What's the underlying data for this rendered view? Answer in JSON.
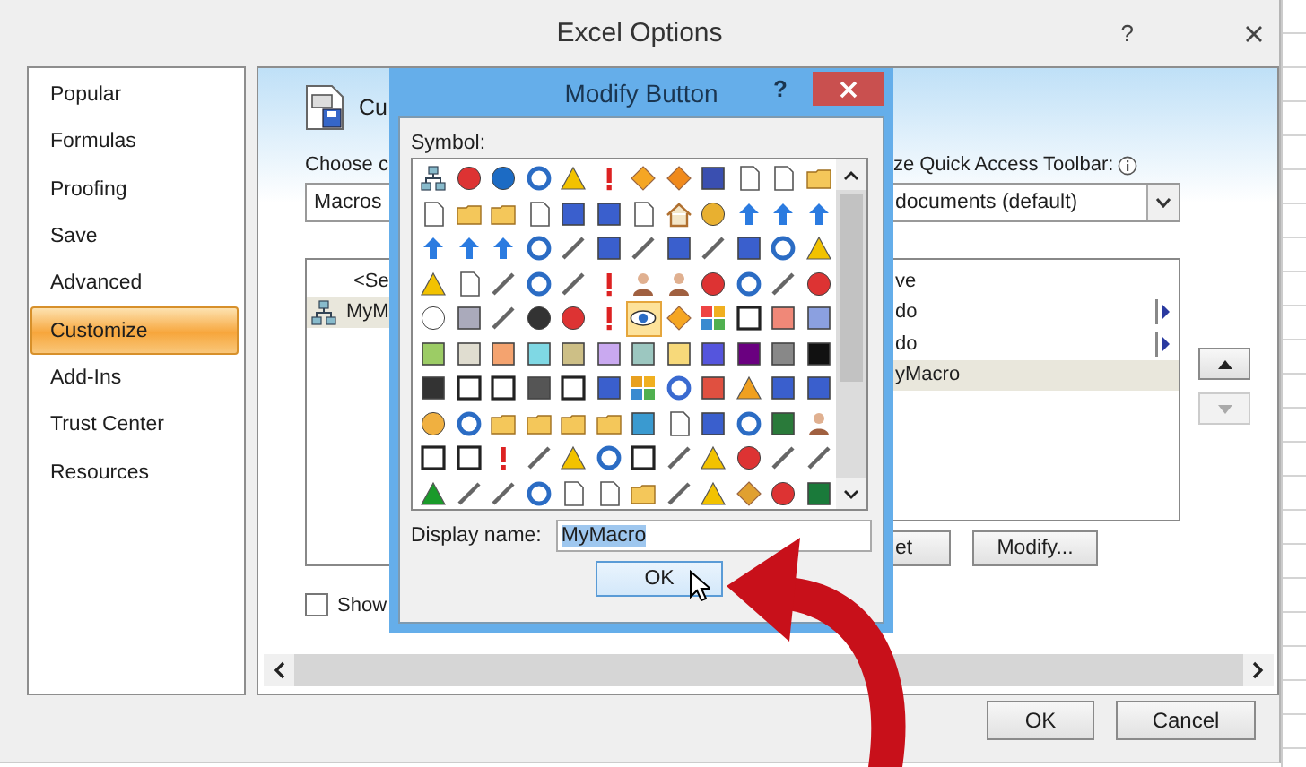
{
  "window": {
    "title": "Excel Options",
    "help": "?"
  },
  "sidebar": {
    "items": [
      {
        "label": "Popular",
        "selected": false
      },
      {
        "label": "Formulas",
        "selected": false
      },
      {
        "label": "Proofing",
        "selected": false
      },
      {
        "label": "Save",
        "selected": false
      },
      {
        "label": "Advanced",
        "selected": false
      },
      {
        "label": "Customize",
        "selected": true
      },
      {
        "label": "Add-Ins",
        "selected": false
      },
      {
        "label": "Trust Center",
        "selected": false
      },
      {
        "label": "Resources",
        "selected": false
      }
    ]
  },
  "customize": {
    "title": "Cu",
    "commands_label": "Choose c",
    "commands_dropdown": "Macros",
    "commands_list": [
      {
        "kind": "separator",
        "label": "<Se",
        "selected": false
      },
      {
        "kind": "command",
        "label": "MyM",
        "selected": true
      }
    ],
    "show_checkbox": {
      "label": "Show",
      "checked": false
    },
    "toolbar_label": "ze Quick Access Toolbar:",
    "toolbar_dropdown": "documents (default)",
    "toolbar_list": [
      {
        "label": "ve",
        "submenu": false,
        "selected": false
      },
      {
        "label": "do",
        "submenu": true,
        "selected": false
      },
      {
        "label": "do",
        "submenu": true,
        "selected": false
      },
      {
        "label": "yMacro",
        "submenu": false,
        "selected": true
      }
    ],
    "list_buttons": [
      "et",
      "Modify..."
    ],
    "move_up": {
      "disabled": false
    },
    "move_down": {
      "disabled": true
    }
  },
  "footer_buttons": [
    "OK",
    "Cancel"
  ],
  "modify_dialog": {
    "title": "Modify Button",
    "help": "?",
    "symbol_label": "Symbol:",
    "symbols": [
      {
        "selected": false
      },
      {
        "selected": false
      },
      {
        "selected": false
      },
      {
        "selected": false
      },
      {
        "selected": false
      },
      {
        "selected": false
      },
      {
        "selected": false
      },
      {
        "selected": false
      },
      {
        "selected": false
      },
      {
        "selected": false
      },
      {
        "selected": false
      },
      {
        "selected": false
      },
      {
        "selected": false
      },
      {
        "selected": false
      },
      {
        "selected": false
      },
      {
        "selected": false
      },
      {
        "selected": false
      },
      {
        "selected": false
      },
      {
        "selected": false
      },
      {
        "selected": false
      },
      {
        "selected": false
      },
      {
        "selected": false
      },
      {
        "selected": false
      },
      {
        "selected": false
      },
      {
        "selected": false
      },
      {
        "selected": false
      },
      {
        "selected": false
      },
      {
        "selected": false
      },
      {
        "selected": false
      },
      {
        "selected": false
      },
      {
        "selected": false
      },
      {
        "selected": false
      },
      {
        "selected": false
      },
      {
        "selected": false
      },
      {
        "selected": false
      },
      {
        "selected": false
      },
      {
        "selected": false
      },
      {
        "selected": false
      },
      {
        "selected": false
      },
      {
        "selected": false
      },
      {
        "selected": false
      },
      {
        "selected": false
      },
      {
        "selected": false
      },
      {
        "selected": false
      },
      {
        "selected": false
      },
      {
        "selected": false
      },
      {
        "selected": false
      },
      {
        "selected": false
      },
      {
        "selected": false
      },
      {
        "selected": false
      },
      {
        "selected": false
      },
      {
        "selected": false
      },
      {
        "selected": false
      },
      {
        "selected": false
      },
      {
        "selected": true
      },
      {
        "selected": false
      },
      {
        "selected": false
      },
      {
        "selected": false
      },
      {
        "selected": false
      },
      {
        "selected": false
      },
      {
        "selected": false
      },
      {
        "selected": false
      },
      {
        "selected": false
      },
      {
        "selected": false
      },
      {
        "selected": false
      },
      {
        "selected": false
      },
      {
        "selected": false
      },
      {
        "selected": false
      },
      {
        "selected": false
      },
      {
        "selected": false
      },
      {
        "selected": false
      },
      {
        "selected": false
      },
      {
        "selected": false
      },
      {
        "selected": false
      },
      {
        "selected": false
      },
      {
        "selected": false
      },
      {
        "selected": false
      },
      {
        "selected": false
      },
      {
        "selected": false
      },
      {
        "selected": false
      },
      {
        "selected": false
      },
      {
        "selected": false
      },
      {
        "selected": false
      },
      {
        "selected": false
      },
      {
        "selected": false
      },
      {
        "selected": false
      },
      {
        "selected": false
      },
      {
        "selected": false
      },
      {
        "selected": false
      },
      {
        "selected": false
      },
      {
        "selected": false
      },
      {
        "selected": false
      },
      {
        "selected": false
      },
      {
        "selected": false
      },
      {
        "selected": false
      },
      {
        "selected": false
      },
      {
        "selected": false
      },
      {
        "selected": false
      },
      {
        "selected": false
      },
      {
        "selected": false
      },
      {
        "selected": false
      },
      {
        "selected": false
      },
      {
        "selected": false
      },
      {
        "selected": false
      },
      {
        "selected": false
      },
      {
        "selected": false
      },
      {
        "selected": false
      },
      {
        "selected": false
      },
      {
        "selected": false
      },
      {
        "selected": false
      },
      {
        "selected": false
      },
      {
        "selected": false
      },
      {
        "selected": false
      },
      {
        "selected": false
      },
      {
        "selected": false
      },
      {
        "selected": false
      },
      {
        "selected": false
      },
      {
        "selected": false
      },
      {
        "selected": false
      },
      {
        "selected": false
      }
    ],
    "display_name_label": "Display name:",
    "display_name": "MyMacro",
    "ok_button": "OK"
  }
}
